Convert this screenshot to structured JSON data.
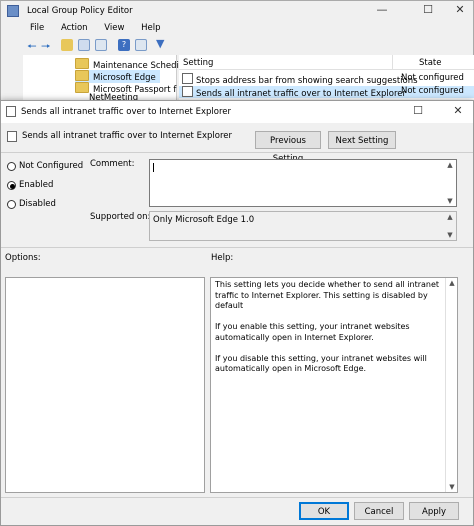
{
  "bg_window": {
    "title": "Local Group Policy Editor",
    "menu": [
      "File",
      "Action",
      "View",
      "Help"
    ],
    "tree_items": [
      "Maintenance Schedi",
      "Microsoft Edge",
      "Microsoft Passport f",
      "NetMeeting"
    ],
    "list_headers": {
      "setting": "Setting",
      "state": "State"
    },
    "rows": [
      {
        "setting": "Stops address bar from showing search suggestions",
        "state": "Not configured"
      },
      {
        "setting": "Sends all intranet traffic over to Internet Explorer",
        "state": "Not configured"
      }
    ]
  },
  "dialog": {
    "title": "Sends all intranet traffic over to Internet Explorer",
    "header_label": "Sends all intranet traffic over to Internet Explorer",
    "prev_button": "Previous Setting",
    "next_button": "Next Setting",
    "radio_options": [
      "Not Configured",
      "Enabled",
      "Disabled"
    ],
    "selected_option": "Enabled",
    "comment_label": "Comment:",
    "comment_value": "",
    "supported_label": "Supported on:",
    "supported_value": "Only Microsoft Edge 1.0",
    "options_label": "Options:",
    "help_label": "Help:",
    "help_text": "This setting lets you decide whether to send all intranet traffic to Internet Explorer. This setting is disabled by default\n\nIf you enable this setting, your intranet websites automatically open in Internet Explorer.\n\nIf you disable this setting, your intranet websites will automatically open in Microsoft Edge.",
    "ok_button": "OK",
    "cancel_button": "Cancel",
    "apply_button": "Apply"
  }
}
